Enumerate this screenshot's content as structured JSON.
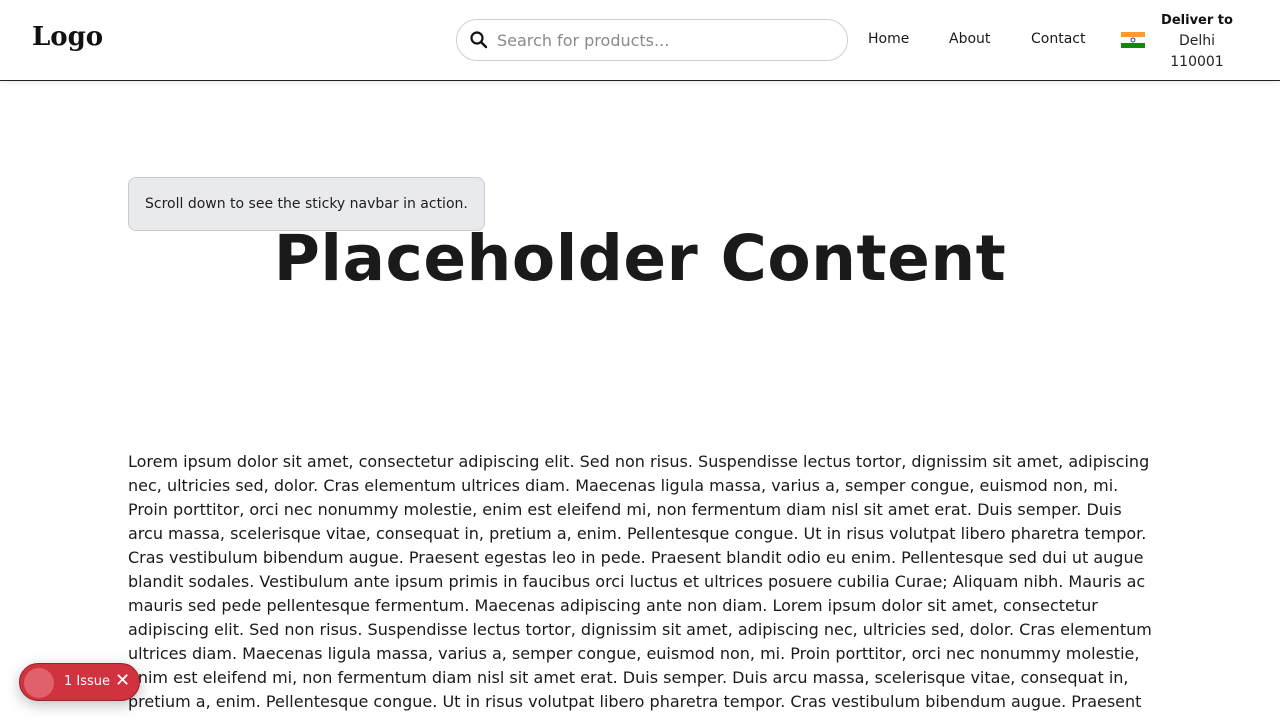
{
  "header": {
    "logo": "Logo",
    "search": {
      "placeholder": "Search for products...",
      "value": "",
      "icon": "search-icon"
    },
    "nav": [
      {
        "label": "Home"
      },
      {
        "label": "About"
      },
      {
        "label": "Contact"
      }
    ],
    "delivery": {
      "flag_icon": "india-flag-icon",
      "flag_colors": [
        "#FF9933",
        "#FFFFFF",
        "#138808"
      ],
      "label": "Deliver to",
      "city": "Delhi",
      "pincode": "110001"
    }
  },
  "main": {
    "tooltip": "Scroll down to see the sticky navbar in action.",
    "title": "Placeholder Content",
    "paragraph": "Lorem ipsum dolor sit amet, consectetur adipiscing elit. Sed non risus. Suspendisse lectus tortor, dignissim sit amet, adipiscing nec, ultricies sed, dolor. Cras elementum ultrices diam. Maecenas ligula massa, varius a, semper congue, euismod non, mi. Proin porttitor, orci nec nonummy molestie, enim est eleifend mi, non fermentum diam nisl sit amet erat. Duis semper. Duis arcu massa, scelerisque vitae, consequat in, pretium a, enim. Pellentesque congue. Ut in risus volutpat libero pharetra tempor. Cras vestibulum bibendum augue. Praesent egestas leo in pede. Praesent blandit odio eu enim. Pellentesque sed dui ut augue blandit sodales. Vestibulum ante ipsum primis in faucibus orci luctus et ultrices posuere cubilia Curae; Aliquam nibh. Mauris ac mauris sed pede pellentesque fermentum. Maecenas adipiscing ante non diam. Lorem ipsum dolor sit amet, consectetur adipiscing elit. Sed non risus. Suspendisse lectus tortor, dignissim sit amet, adipiscing nec, ultricies sed, dolor. Cras elementum ultrices diam. Maecenas ligula massa, varius a, semper congue, euismod non, mi. Proin porttitor, orci nec nonummy molestie, enim est eleifend mi, non fermentum diam nisl sit amet erat. Duis semper. Duis arcu massa, scelerisque vitae, consequat in, pretium a, enim. Pellentesque congue. Ut in risus volutpat libero pharetra tempor. Cras vestibulum bibendum augue. Praesent"
  },
  "issues_badge": {
    "label": "1 Issue",
    "close_icon": "close-icon",
    "color": "#d0333f"
  }
}
